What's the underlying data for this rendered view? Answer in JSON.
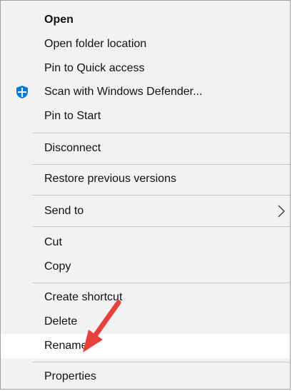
{
  "menu": {
    "items": [
      {
        "label": "Open"
      },
      {
        "label": "Open folder location"
      },
      {
        "label": "Pin to Quick access"
      },
      {
        "label": "Scan with Windows Defender..."
      },
      {
        "label": "Pin to Start"
      },
      {
        "label": "Disconnect"
      },
      {
        "label": "Restore previous versions"
      },
      {
        "label": "Send to"
      },
      {
        "label": "Cut"
      },
      {
        "label": "Copy"
      },
      {
        "label": "Create shortcut"
      },
      {
        "label": "Delete"
      },
      {
        "label": "Rename"
      },
      {
        "label": "Properties"
      }
    ]
  },
  "icons": {
    "defender": "shield-icon",
    "submenu": "chevron-right-icon",
    "annotation": "red-arrow-icon"
  },
  "colors": {
    "menu_background": "#f2f2f2",
    "hover_background": "#ffffff",
    "defender_blue": "#0a78d7",
    "annotation_red": "#e8403c"
  }
}
